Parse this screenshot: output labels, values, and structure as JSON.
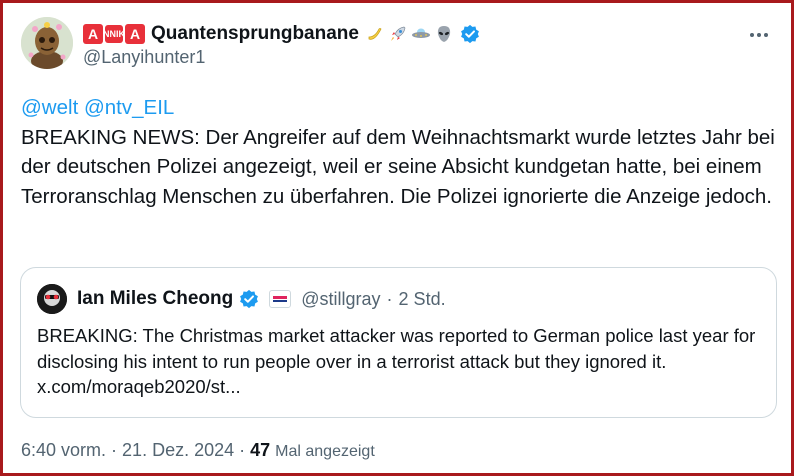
{
  "author": {
    "letter_badges": [
      "A",
      "NNIK",
      "A"
    ],
    "display_name": "Quantensprungbanane",
    "emoji_icons": [
      "banana-icon",
      "rocket-icon",
      "ufo-icon",
      "alien-icon"
    ],
    "handle": "@Lanyihunter1",
    "verified": true
  },
  "tweet": {
    "mentions": "@welt @ntv_EIL",
    "text": "BREAKING NEWS: Der Angreifer auf dem Weihnachtsmarkt wurde letztes Jahr bei der deutschen Polizei angezeigt, weil er seine Absicht kundgetan hatte, bei einem Terroranschlag Menschen zu überfahren. Die Polizei ignorierte die Anzeige jedoch."
  },
  "quote": {
    "display_name": "Ian Miles Cheong",
    "handle": "@stillgray",
    "separator": "·",
    "time": "2 Std.",
    "text": "BREAKING: The Christmas market attacker was reported to German police last year for disclosing his intent to run people over in a terrorist attack but they ignored it. x.com/moraqeb2020/st..."
  },
  "meta": {
    "time": "6:40 vorm.",
    "sep1": "·",
    "date": "21. Dez. 2024",
    "sep2": "·",
    "views": "47",
    "views_label": "Mal angezeigt"
  },
  "colors": {
    "frame": "#a8191c",
    "link": "#1d9bf0",
    "verified": "#1d9bf0",
    "secondary_text": "#536471"
  }
}
